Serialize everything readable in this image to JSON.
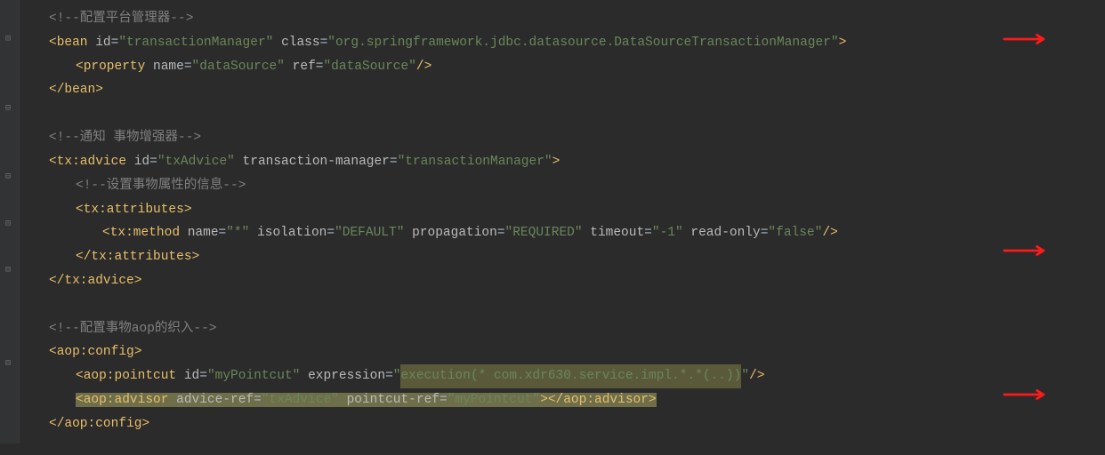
{
  "lines": {
    "l1": "<!--配置平台管理器-->",
    "l2_open": "<bean",
    "l2_id_attr": "id",
    "l2_id_val": "\"transactionManager\"",
    "l2_class_attr": "class",
    "l2_class_val": "\"org.springframework.jdbc.datasource.DataSourceTransactionManager\"",
    "l2_close": ">",
    "l3_open": "<property",
    "l3_name_attr": "name",
    "l3_name_val": "\"dataSource\"",
    "l3_ref_attr": "ref",
    "l3_ref_val": "\"dataSource\"",
    "l3_close": "/>",
    "l4": "</bean>",
    "l6": "<!--通知 事物增强器-->",
    "l7_open": "<tx:advice",
    "l7_id_attr": "id",
    "l7_id_val": "\"txAdvice\"",
    "l7_tm_attr": "transaction-manager",
    "l7_tm_val": "\"transactionManager\"",
    "l7_close": ">",
    "l8": "<!--设置事物属性的信息-->",
    "l9_open": "<tx:attributes>",
    "l10_open": "<tx:method",
    "l10_name_attr": "name",
    "l10_name_val": "\"*\"",
    "l10_iso_attr": "isolation",
    "l10_iso_val": "\"DEFAULT\"",
    "l10_prop_attr": "propagation",
    "l10_prop_val": "\"REQUIRED\"",
    "l10_to_attr": "timeout",
    "l10_to_val": "\"-1\"",
    "l10_ro_attr": "read-only",
    "l10_ro_val": "\"false\"",
    "l10_close": "/>",
    "l11": "</tx:attributes>",
    "l12": "</tx:advice>",
    "l14": "<!--配置事物aop的织入-->",
    "l15": "<aop:config>",
    "l16_open": "<aop:pointcut",
    "l16_id_attr": "id",
    "l16_id_val": "\"myPointcut\"",
    "l16_ex_attr": "expression",
    "l16_ex_val_q1": "\"",
    "l16_ex_exec": "execution",
    "l16_ex_rest": "(* com.xdr630.service.impl.*.*(..))",
    "l16_ex_val_q2": "\"",
    "l16_close": "/>",
    "l17_open": "<aop:advisor",
    "l17_ar_attr": "advice-ref",
    "l17_ar_val": "\"txAdvice\"",
    "l17_pr_attr": "pointcut-ref",
    "l17_pr_val": "\"myPointcut\"",
    "l17_mid": ">",
    "l17_close": "</aop:advisor>",
    "l18": "</aop:config>"
  },
  "colors": {
    "arrow": "#ff1a1a"
  }
}
